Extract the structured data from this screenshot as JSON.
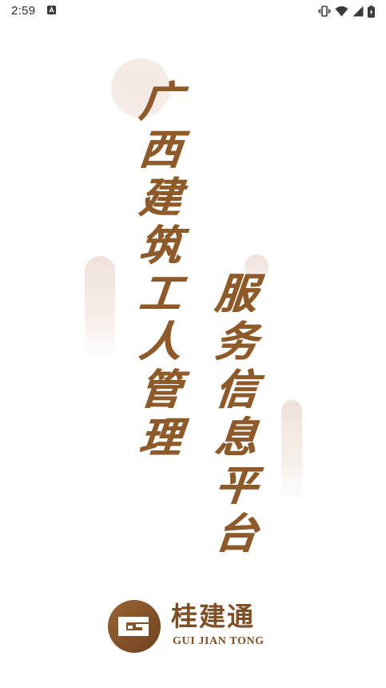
{
  "status_bar": {
    "time": "2:59",
    "icons": [
      "app-notification-icon",
      "vibrate-icon",
      "wifi-icon",
      "signal-icon",
      "battery-icon"
    ]
  },
  "headline": {
    "left_column": [
      "广",
      "西",
      "建",
      "筑",
      "工",
      "人",
      "管",
      "理"
    ],
    "right_column": [
      "服",
      "务",
      "信",
      "息",
      "平",
      "台"
    ]
  },
  "logo": {
    "name": "桂建通",
    "pinyin": "GUI JIAN TONG"
  },
  "colors": {
    "brand_brown": "#8f5a2a",
    "logo_brown": "#7e4f24",
    "deco_tint": "#f3e8e1",
    "background": "#ffffff"
  }
}
